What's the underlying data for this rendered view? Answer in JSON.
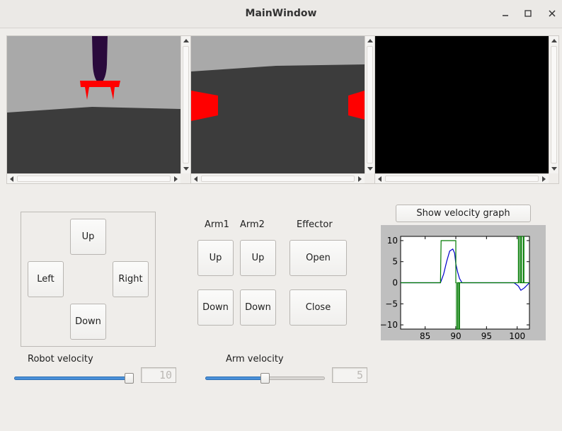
{
  "window": {
    "title": "MainWindow",
    "minimize": "–",
    "maximize": "☐",
    "close": "✕"
  },
  "camera_views": [
    {
      "name": "camera-view-1",
      "description_icon": "gripper-camera"
    },
    {
      "name": "camera-view-2",
      "description_icon": "front-camera"
    },
    {
      "name": "camera-view-3",
      "description_icon": "blank-camera"
    }
  ],
  "robot_controls": {
    "up": "Up",
    "left": "Left",
    "right": "Right",
    "down": "Down"
  },
  "arm_controls": {
    "arm1_label": "Arm1",
    "arm2_label": "Arm2",
    "effector_label": "Effector",
    "arm1_up": "Up",
    "arm1_down": "Down",
    "arm2_up": "Up",
    "arm2_down": "Down",
    "effector_open": "Open",
    "effector_close": "Close"
  },
  "velocity": {
    "robot_label": "Robot velocity",
    "robot_value": "10",
    "robot_level": 1.0,
    "arm_label": "Arm velocity",
    "arm_value": "5",
    "arm_level": 0.5
  },
  "graph_button": "Show velocity graph",
  "colors": {
    "accent": "#4a90d9",
    "blue_series": "#0000cc",
    "green_series": "#007a00",
    "gripper_red": "#ff0000",
    "arm_purple": "#2b0b3a"
  },
  "chart_data": {
    "type": "line",
    "xlim": [
      81,
      102
    ],
    "ylim": [
      -11,
      11
    ],
    "xticks": [
      "85",
      "90",
      "95",
      "100"
    ],
    "yticks": [
      "10",
      "5",
      "0",
      "−5",
      "−10"
    ],
    "grid": false,
    "series": [
      {
        "color": "#0000cc",
        "points": [
          [
            81,
            0
          ],
          [
            87.5,
            0
          ],
          [
            88,
            2
          ],
          [
            88.5,
            5
          ],
          [
            89,
            7.5
          ],
          [
            89.5,
            8
          ],
          [
            89.8,
            7
          ],
          [
            90,
            4.5
          ],
          [
            90.3,
            2.5
          ],
          [
            90.6,
            1
          ],
          [
            91,
            0
          ],
          [
            99.5,
            0
          ],
          [
            100.2,
            -0.8
          ],
          [
            100.6,
            -1.8
          ],
          [
            101.2,
            -1.2
          ],
          [
            102,
            0
          ]
        ]
      },
      {
        "color": "#007a00",
        "points": [
          [
            81,
            0
          ],
          [
            87.5,
            0
          ],
          [
            87.6,
            10
          ],
          [
            90,
            10
          ],
          [
            90,
            0
          ],
          [
            90.1,
            0
          ],
          [
            90.1,
            -11
          ],
          [
            90.3,
            -11
          ],
          [
            90.3,
            0
          ],
          [
            90.5,
            0
          ],
          [
            90.5,
            -11
          ],
          [
            90.6,
            -11
          ],
          [
            90.6,
            0
          ],
          [
            100.2,
            0
          ],
          [
            100.2,
            11
          ],
          [
            100.4,
            11
          ],
          [
            100.4,
            0
          ],
          [
            100.6,
            0
          ],
          [
            100.6,
            11
          ],
          [
            100.7,
            11
          ],
          [
            100.7,
            0
          ],
          [
            101,
            0
          ],
          [
            101,
            11
          ],
          [
            101.1,
            11
          ],
          [
            101.1,
            0
          ],
          [
            102,
            0
          ]
        ]
      }
    ]
  }
}
